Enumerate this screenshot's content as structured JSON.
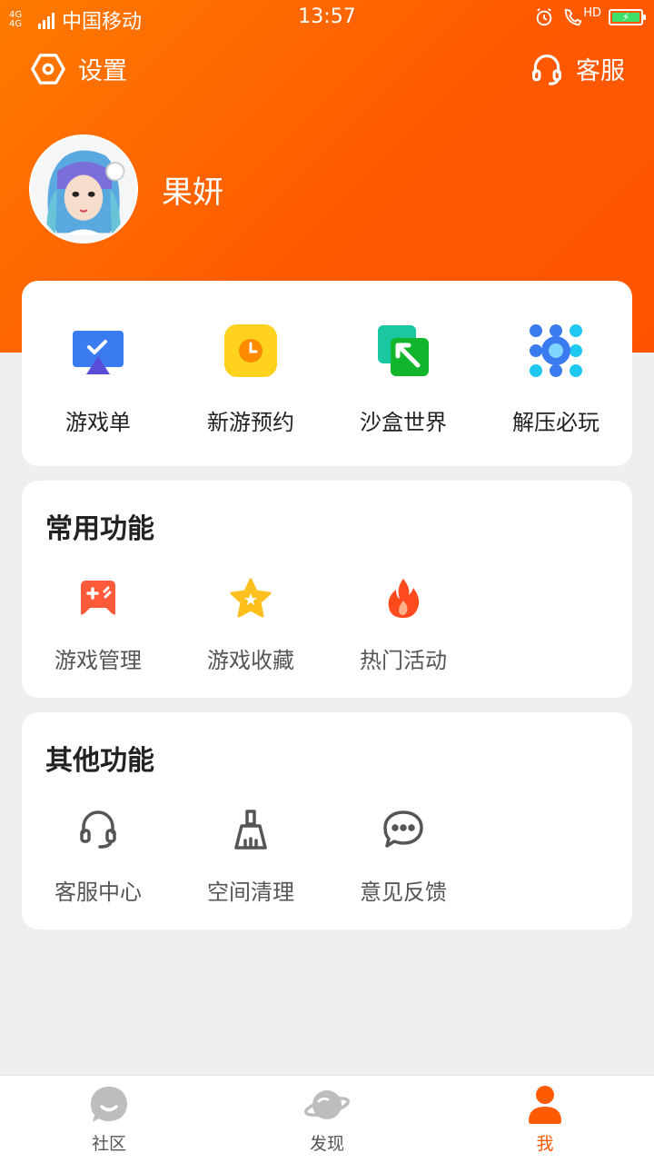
{
  "status_bar": {
    "network": "4G 4G",
    "carrier": "中国移动",
    "time": "13:57",
    "hd": "HD"
  },
  "header": {
    "settings_label": "设置",
    "service_label": "客服",
    "username": "果妍"
  },
  "shortcuts": [
    {
      "label": "游戏单",
      "icon": "game-list-icon"
    },
    {
      "label": "新游预约",
      "icon": "clock-icon"
    },
    {
      "label": "沙盒世界",
      "icon": "pickaxe-icon"
    },
    {
      "label": "解压必玩",
      "icon": "dots-circle-icon"
    }
  ],
  "common": {
    "title": "常用功能",
    "items": [
      {
        "label": "游戏管理",
        "icon": "gamepad-icon"
      },
      {
        "label": "游戏收藏",
        "icon": "star-icon"
      },
      {
        "label": "热门活动",
        "icon": "fire-icon"
      }
    ]
  },
  "other": {
    "title": "其他功能",
    "items": [
      {
        "label": "客服中心",
        "icon": "headset-icon"
      },
      {
        "label": "空间清理",
        "icon": "broom-icon"
      },
      {
        "label": "意见反馈",
        "icon": "chat-bubble-icon"
      }
    ]
  },
  "bottom_nav": [
    {
      "label": "社区",
      "icon": "community-icon",
      "active": false
    },
    {
      "label": "发现",
      "icon": "planet-icon",
      "active": false
    },
    {
      "label": "我",
      "icon": "person-icon",
      "active": true
    }
  ],
  "colors": {
    "accent": "#ff5a00",
    "header_gradient_start": "#ff7a00",
    "page_bg": "#efefef"
  }
}
